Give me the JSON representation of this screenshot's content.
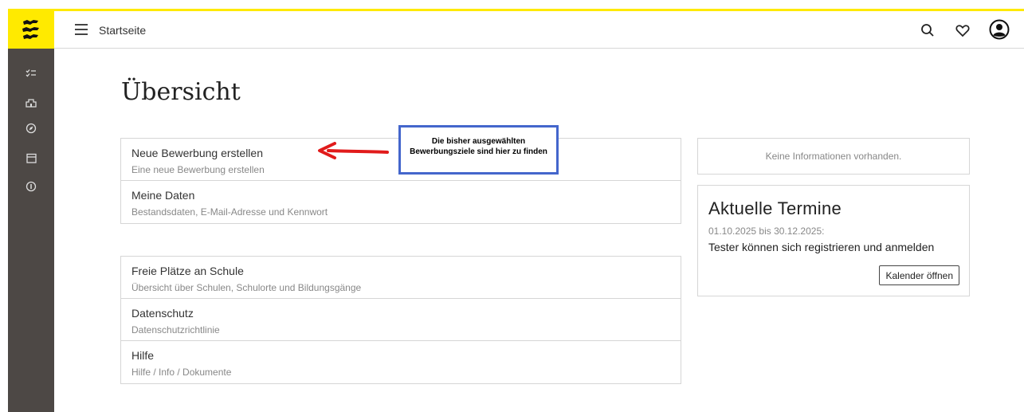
{
  "header": {
    "breadcrumb": "Startseite",
    "icons": [
      "search-icon",
      "heart-icon",
      "account-icon"
    ]
  },
  "sidebar": {
    "icons": [
      "checklist-icon",
      "school-icon",
      "compass-icon",
      "calendar-icon",
      "info-icon"
    ]
  },
  "page": {
    "title": "Übersicht"
  },
  "main_links": [
    {
      "title": "Neue Bewerbung erstellen",
      "subtitle": "Eine neue Bewerbung erstellen"
    },
    {
      "title": "Meine Daten",
      "subtitle": "Bestandsdaten, E-Mail-Adresse und Kennwort"
    }
  ],
  "secondary_links": [
    {
      "title": "Freie Plätze an Schule",
      "subtitle": "Übersicht über Schulen, Schulorte und Bildungsgänge"
    },
    {
      "title": "Datenschutz",
      "subtitle": "Datenschutzrichtlinie"
    },
    {
      "title": "Hilfe",
      "subtitle": "Hilfe / Info / Dokumente"
    }
  ],
  "info": {
    "text": "Keine Informationen vorhanden."
  },
  "termine": {
    "title": "Aktuelle Termine",
    "date": "01.10.2025 bis 30.12.2025:",
    "text": "Tester können sich registrieren und anmelden",
    "button_label": "Kalender öffnen"
  },
  "annotation": {
    "line1": "Die bisher ausgewählten",
    "line2": "Bewerbungsziele sind hier zu finden"
  },
  "colors": {
    "brand_yellow": "#ffea00",
    "sidebar_bg": "#4d4845",
    "annotation_border": "#4466cc",
    "arrow": "#e11b1b"
  }
}
